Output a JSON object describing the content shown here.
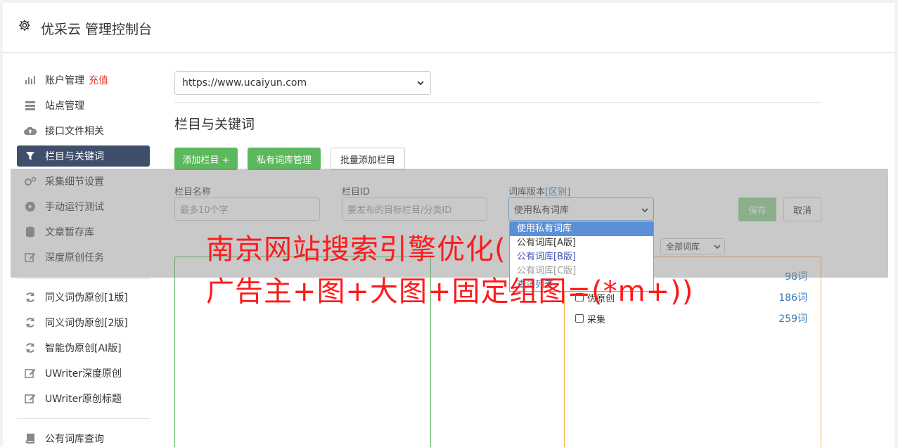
{
  "header": {
    "title": "优采云 管理控制台"
  },
  "sidebar": {
    "items": [
      {
        "label": "账户管理",
        "extra": "充值"
      },
      {
        "label": "站点管理"
      },
      {
        "label": "接口文件相关"
      },
      {
        "label": "栏目与关键词"
      },
      {
        "label": "采集细节设置"
      },
      {
        "label": "手动运行测试"
      },
      {
        "label": "文章暂存库"
      },
      {
        "label": "深度原创任务"
      },
      {
        "label": "同义词伪原创[1版]"
      },
      {
        "label": "同义词伪原创[2版]"
      },
      {
        "label": "智能伪原创[AI版]"
      },
      {
        "label": "UWriter深度原创"
      },
      {
        "label": "UWriter原创标题"
      },
      {
        "label": "公有词库查询"
      }
    ]
  },
  "site_select": {
    "value": "https://www.ucaiyun.com"
  },
  "section_title": "栏目与关键词",
  "buttons": {
    "add_column": "添加栏目 +",
    "private_lib": "私有词库管理",
    "batch_add": "批量添加栏目",
    "save": "保存",
    "cancel": "取消"
  },
  "form": {
    "col_name_label": "栏目名称",
    "col_name_placeholder": "最多10个字",
    "col_id_label": "栏目ID",
    "col_id_placeholder": "要发布的目标栏目/分类ID",
    "lib_version_label": "词库版本",
    "lib_version_link": "[区别]",
    "lib_version_value": "使用私有词库"
  },
  "dropdown_options": [
    "使用私有词库",
    "公有词库[A版]",
    "公有词库[B版]",
    "公有词库[C版]",
    "查词列表"
  ],
  "all_lib_select": "全部词库",
  "library_rows": [
    {
      "label": "",
      "count": "98词"
    },
    {
      "label": "伪原创",
      "count": "186词"
    },
    {
      "label": "采集",
      "count": "259词"
    }
  ],
  "watermark": {
    "line1": "南京网站搜索引擎优化(",
    "line2": "广告主+图+大图+固定组图=(*m+))"
  },
  "colors": {
    "active_nav": "#3f4e6b",
    "green": "#5cb85c",
    "watermark": "#ff1a1a",
    "left_box_border": "#5cb85c",
    "right_box_border": "#f0ad4e"
  }
}
